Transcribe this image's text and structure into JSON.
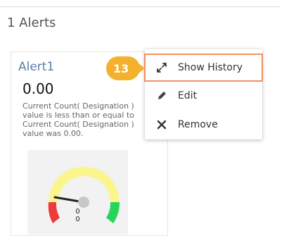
{
  "page": {
    "title": "1 Alerts"
  },
  "alert_card": {
    "name": "Alert1",
    "value": "0.00",
    "description_lines": [
      "Current Count( Designation )",
      "value is less than or equal to",
      "Current Count( Designation )",
      "value was 0.00."
    ],
    "gauge": {
      "readout_line1": "0",
      "readout_line2": "0",
      "colors": {
        "low": "#f03a3a",
        "mid": "#fbf58e",
        "high": "#26d65b",
        "needle": "#222222",
        "hub": "#c7c7c7"
      }
    }
  },
  "context_menu": {
    "items": [
      {
        "label": "Show History",
        "icon": "expand-icon"
      },
      {
        "label": "Edit",
        "icon": "pencil-icon"
      },
      {
        "label": "Remove",
        "icon": "close-icon"
      }
    ]
  },
  "step_badge": {
    "label": "13",
    "color": "#f3b12e"
  },
  "colors": {
    "accent": "#5b7fa9",
    "highlight": "#f0915f"
  }
}
